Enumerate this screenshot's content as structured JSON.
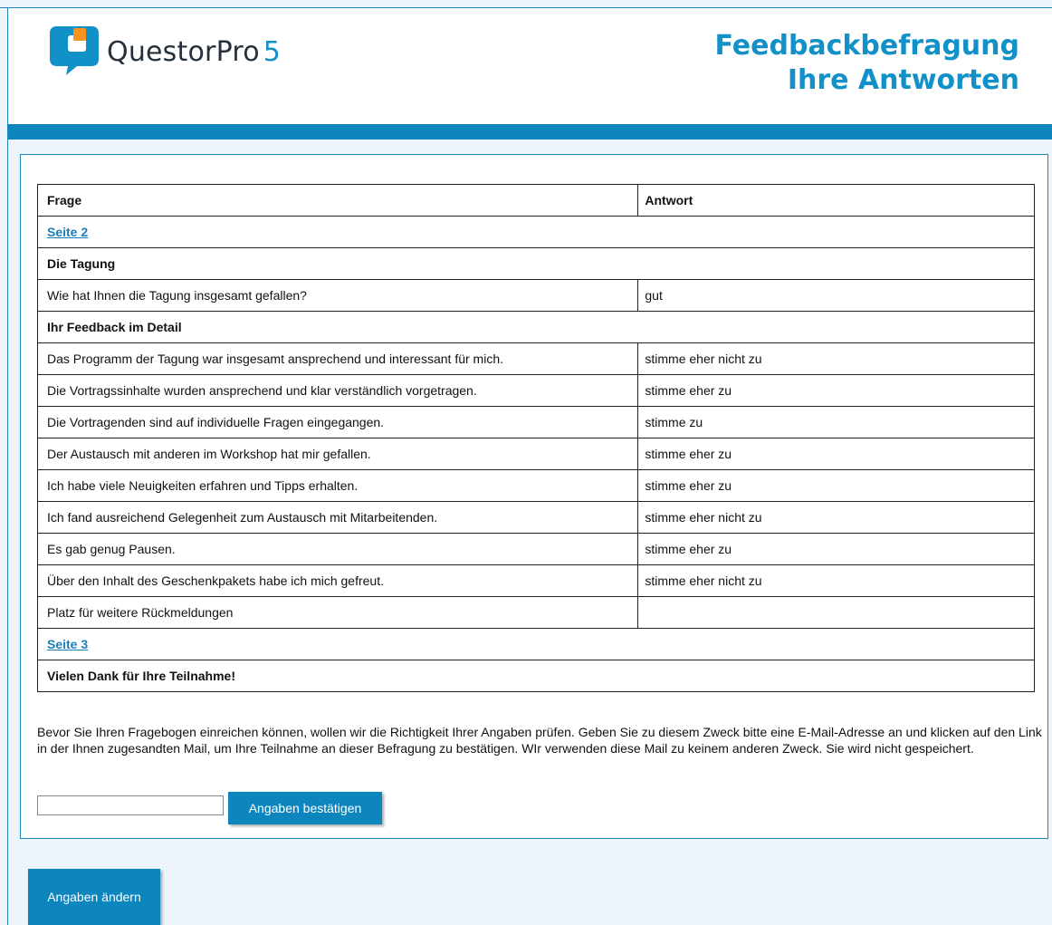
{
  "brand": {
    "name": "QuestorPro",
    "version": "5"
  },
  "header": {
    "title_line1": "Feedbackbefragung",
    "title_line2": "Ihre Antworten"
  },
  "table": {
    "col_question": "Frage",
    "col_answer": "Antwort",
    "rows": [
      {
        "type": "link",
        "text": "Seite 2"
      },
      {
        "type": "section",
        "text": "Die Tagung"
      },
      {
        "type": "qa",
        "q": "Wie hat Ihnen die Tagung insgesamt gefallen?",
        "a": "gut"
      },
      {
        "type": "section",
        "text": "Ihr Feedback im Detail"
      },
      {
        "type": "qa",
        "q": "Das Programm der Tagung war insgesamt ansprechend und interessant für mich.",
        "a": "stimme eher nicht zu"
      },
      {
        "type": "qa",
        "q": "Die Vortragssinhalte wurden ansprechend und klar verständlich vorgetragen.",
        "a": "stimme eher zu"
      },
      {
        "type": "qa",
        "q": "Die Vortragenden sind auf individuelle Fragen eingegangen.",
        "a": "stimme zu"
      },
      {
        "type": "qa",
        "q": "Der Austausch mit anderen im Workshop hat mir gefallen.",
        "a": "stimme eher zu"
      },
      {
        "type": "qa",
        "q": "Ich habe viele Neuigkeiten erfahren und Tipps erhalten.",
        "a": "stimme eher zu"
      },
      {
        "type": "qa",
        "q": "Ich fand ausreichend Gelegenheit zum Austausch mit Mitarbeitenden.",
        "a": "stimme eher nicht zu"
      },
      {
        "type": "qa",
        "q": "Es gab genug Pausen.",
        "a": "stimme eher zu"
      },
      {
        "type": "qa",
        "q": "Über den Inhalt des Geschenkpakets habe ich mich gefreut.",
        "a": "stimme eher nicht zu"
      },
      {
        "type": "qa",
        "q": "Platz für weitere Rückmeldungen",
        "a": ""
      },
      {
        "type": "link",
        "text": "Seite 3"
      },
      {
        "type": "section",
        "text": "Vielen Dank für Ihre Teilnahme!"
      }
    ]
  },
  "verification": {
    "text": "Bevor Sie Ihren Fragebogen einreichen können, wollen wir die Richtigkeit Ihrer Angaben prüfen. Geben Sie zu diesem Zweck bitte eine E-Mail-Adresse an und klicken auf den Link in der Ihnen zugesandten Mail, um Ihre Teilnahme an dieser Befragung zu bestätigen. WIr verwenden diese Mail zu keinem anderen Zweck. Sie wird nicht gespeichert.",
    "email_value": "",
    "confirm_label": "Angaben bestätigen"
  },
  "change_label": "Angaben ändern",
  "colors": {
    "accent": "#0d85bd",
    "title": "#1290c8",
    "logo_orange": "#f7941d"
  }
}
